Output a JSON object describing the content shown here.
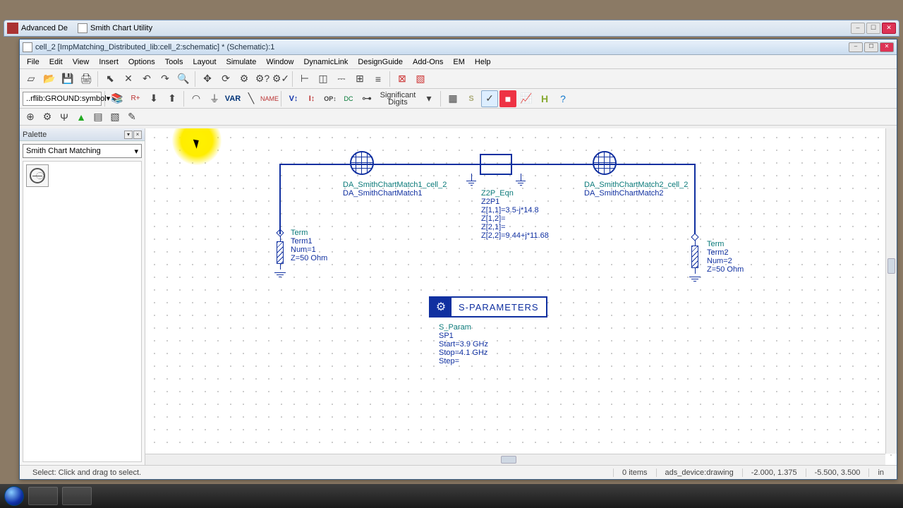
{
  "outer_tabs": {
    "tab1": "Advanced De",
    "tab2": "Smith Chart Utility"
  },
  "window": {
    "title": "cell_2 [ImpMatching_Distributed_lib:cell_2:schematic] * (Schematic):1"
  },
  "menu": [
    "File",
    "Edit",
    "View",
    "Insert",
    "Options",
    "Tools",
    "Layout",
    "Simulate",
    "Window",
    "DynamicLink",
    "DesignGuide",
    "Add-Ons",
    "EM",
    "Help"
  ],
  "toolbar2_combo": "..rflib:GROUND:symbol",
  "toolbar3_labels": {
    "var": "VAR",
    "name": "NAME",
    "sig1": "Significant",
    "sig2": "Digits"
  },
  "palette": {
    "title": "Palette",
    "category": "Smith Chart Matching"
  },
  "schematic": {
    "term1": {
      "name": "Term",
      "inst": "Term1",
      "num": "Num=1",
      "z": "Z=50 Ohm"
    },
    "term2": {
      "name": "Term",
      "inst": "Term2",
      "num": "Num=2",
      "z": "Z=50 Ohm"
    },
    "da1": {
      "line1": "DA_SmithChartMatch1_cell_2",
      "line2": "DA_SmithChartMatch1"
    },
    "da2": {
      "line1": "DA_SmithChartMatch2_cell_2",
      "line2": "DA_SmithChartMatch2"
    },
    "z2p": {
      "name": "Z2P_Eqn",
      "inst": "Z2P1",
      "l1": "Z[1,1]=3.5-j*14.8",
      "l2": "Z[1,2]=",
      "l3": "Z[2,1]=",
      "l4": "Z[2,2]=9.44+j*11.68"
    },
    "sparam": {
      "header": "S-PARAMETERS",
      "name": "S_Param",
      "inst": "SP1",
      "start": "Start=3.9 GHz",
      "stop": "Stop=4.1 GHz",
      "step": "Step="
    }
  },
  "status": {
    "hint": "Select: Click and drag to select.",
    "items": "0 items",
    "layer": "ads_device:drawing",
    "coord1": "-2.000, 1.375",
    "coord2": "-5.500, 3.500",
    "unit": "in"
  }
}
